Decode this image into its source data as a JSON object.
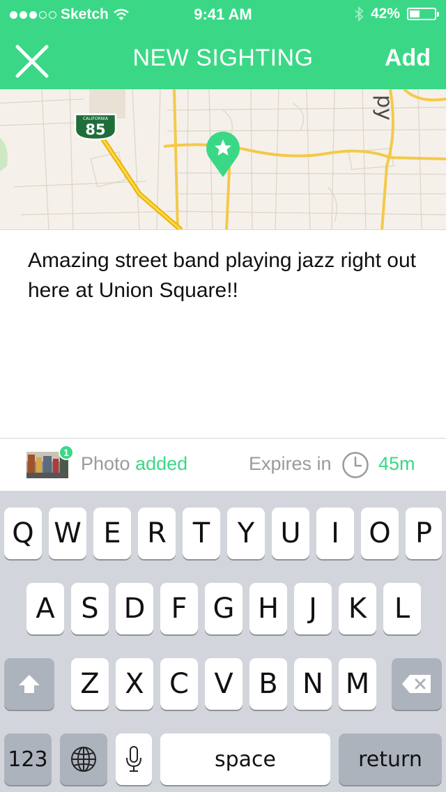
{
  "status_bar": {
    "signal_dots_filled": 3,
    "signal_dots_total": 5,
    "carrier": "Sketch",
    "time": "9:41 AM",
    "battery_percent": "42%",
    "battery_level": 0.42,
    "icons": [
      "wifi-icon",
      "bluetooth-icon",
      "battery-icon"
    ]
  },
  "nav": {
    "close_icon": "close-icon",
    "title": "NEW SIGHTING",
    "add_label": "Add"
  },
  "map": {
    "highway_shield_top": "CALIFORNIA",
    "highway_number": "85",
    "partial_label": "py",
    "pin_icon": "star-pin-icon"
  },
  "message": {
    "text": "Amazing street band playing jazz right out here at Union Square!!"
  },
  "info_bar": {
    "photo_count": "1",
    "photo_label": "Photo",
    "photo_status": "added",
    "expires_label": "Expires in",
    "expires_value": "45m"
  },
  "keyboard": {
    "row1": [
      "Q",
      "W",
      "E",
      "R",
      "T",
      "Y",
      "U",
      "I",
      "O",
      "P"
    ],
    "row2": [
      "A",
      "S",
      "D",
      "F",
      "G",
      "H",
      "J",
      "K",
      "L"
    ],
    "row3": [
      "Z",
      "X",
      "C",
      "V",
      "B",
      "N",
      "M"
    ],
    "numbers_label": "123",
    "space_label": "space",
    "return_label": "return",
    "shift_icon": "shift-icon",
    "delete_icon": "delete-icon",
    "globe_icon": "globe-icon",
    "mic_icon": "microphone-icon"
  },
  "colors": {
    "accent": "#3ad886",
    "map_background": "#f5f1ea",
    "keyboard_background": "#d2d5db",
    "muted_text": "#9a9a9a"
  }
}
